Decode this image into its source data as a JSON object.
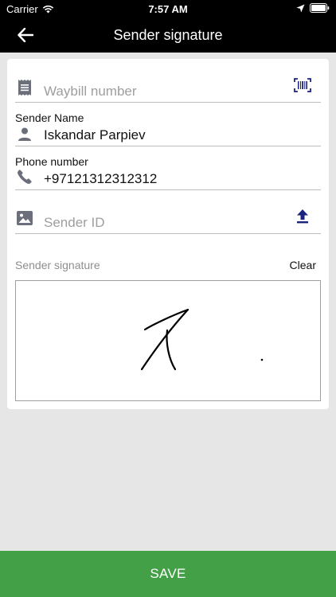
{
  "status_bar": {
    "carrier": "Carrier",
    "time": "7:57 AM"
  },
  "app_bar": {
    "title": "Sender signature"
  },
  "form": {
    "waybill": {
      "placeholder": "Waybill number",
      "value": ""
    },
    "sender_name": {
      "label": "Sender Name",
      "value": "Iskandar Parpiev"
    },
    "phone": {
      "label": "Phone number",
      "value": "+97121312312312"
    },
    "sender_id": {
      "placeholder": "Sender ID",
      "value": ""
    }
  },
  "signature": {
    "label": "Sender signature",
    "clear_label": "Clear"
  },
  "actions": {
    "save_label": "SAVE"
  },
  "colors": {
    "accent_green": "#43a047",
    "icon_grey": "#6b6f7b",
    "icon_navy": "#1a237e"
  }
}
